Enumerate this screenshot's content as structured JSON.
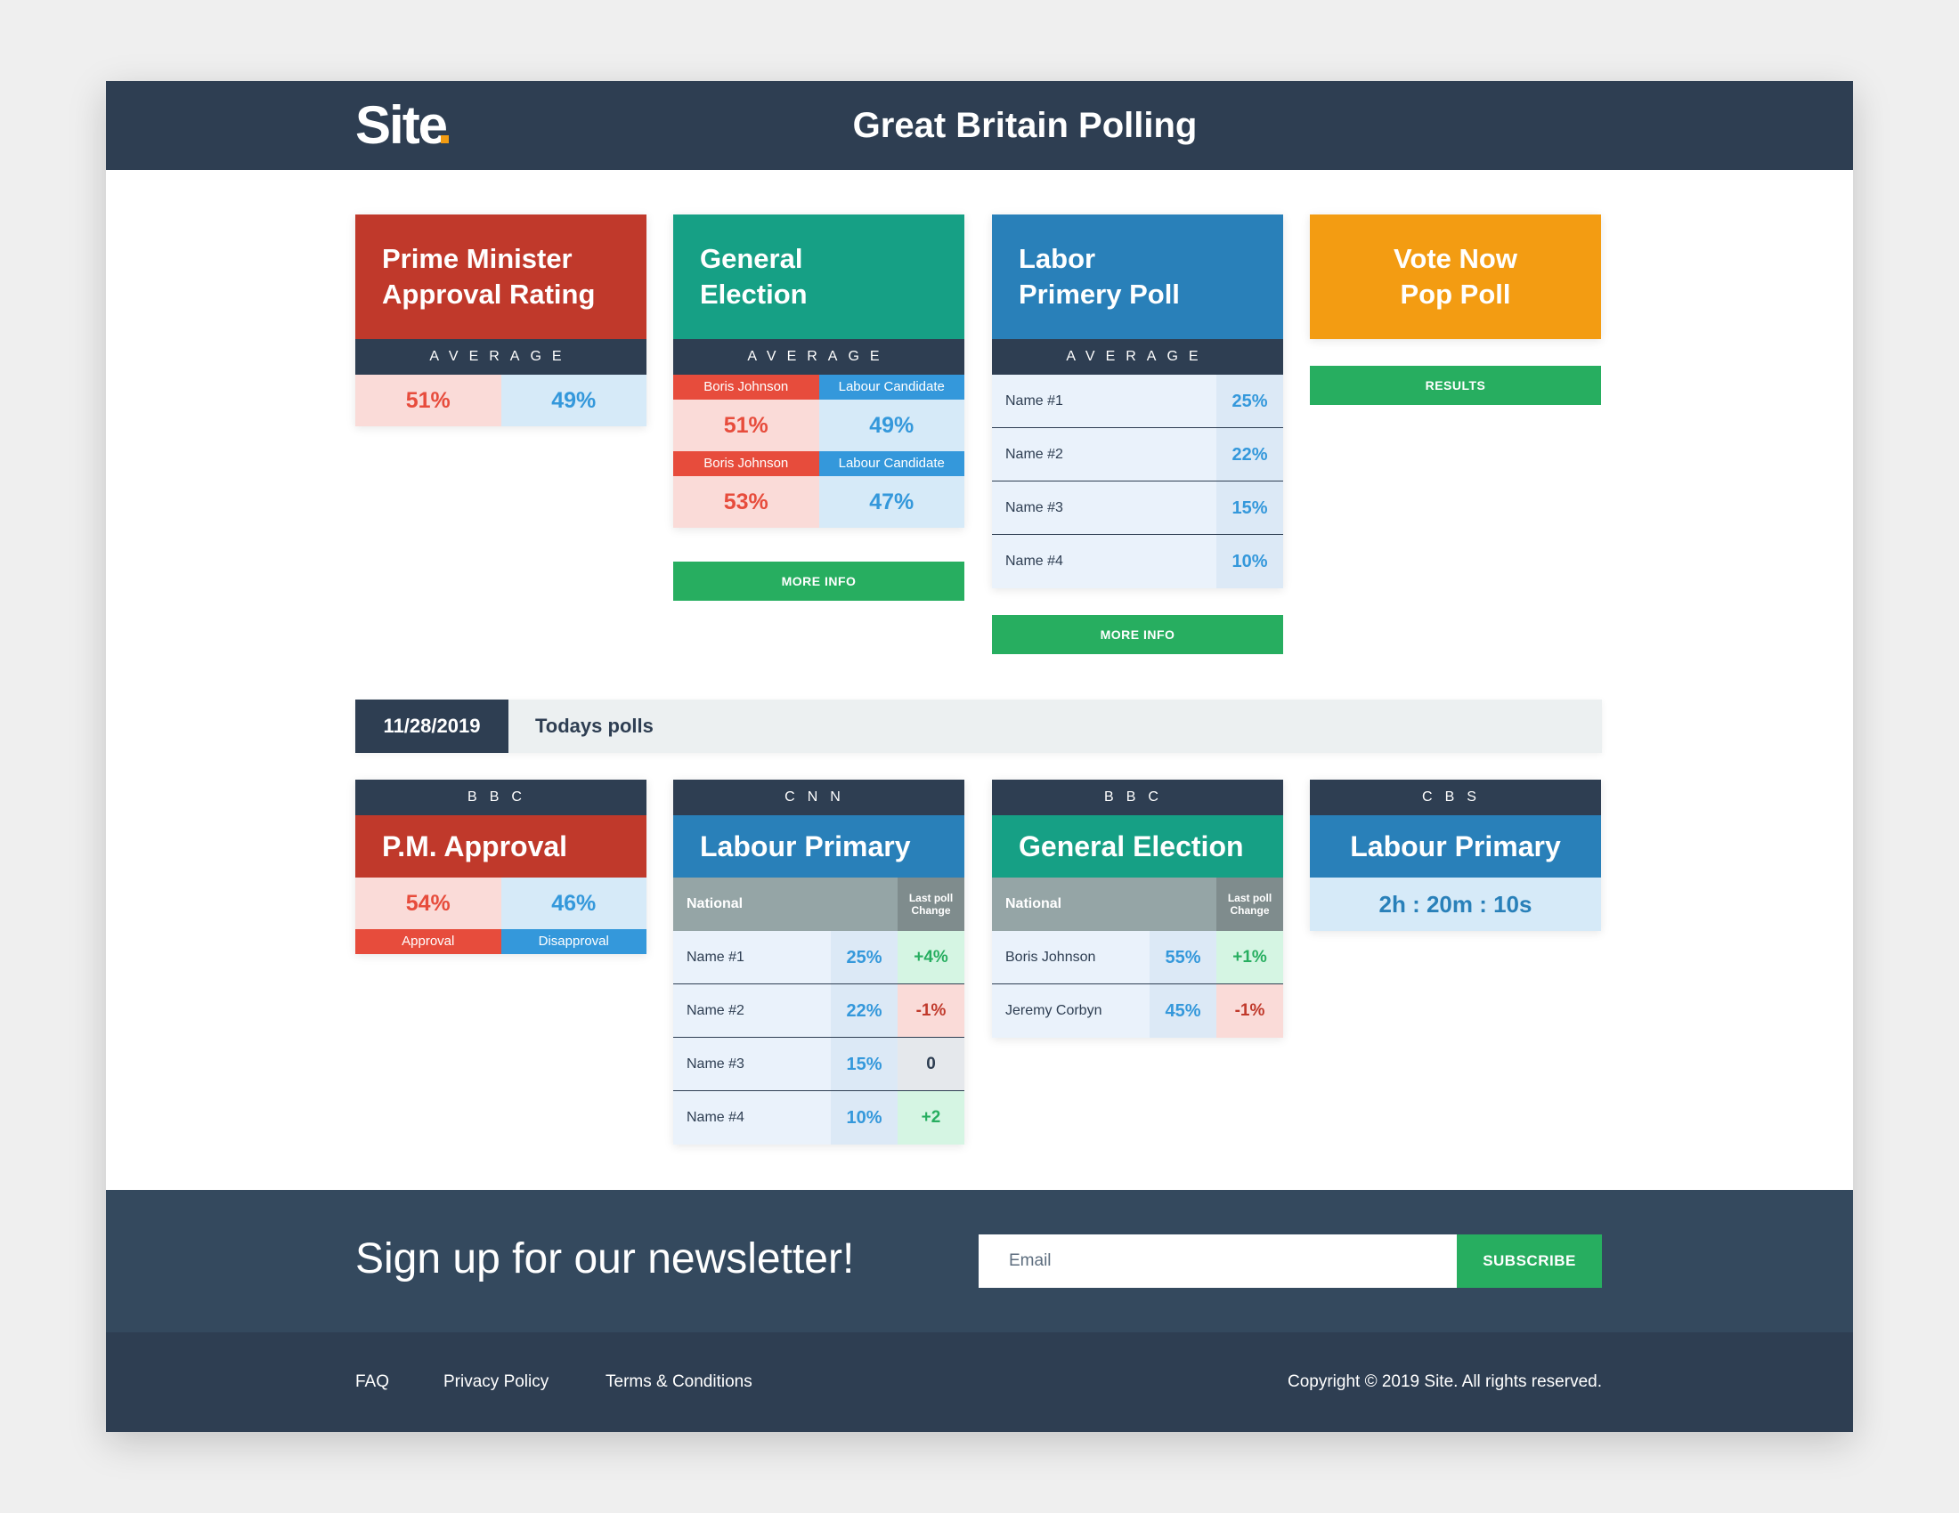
{
  "header": {
    "logo": "Site",
    "title": "Great Britain Polling"
  },
  "cards": {
    "pm": {
      "title_line1": "Prime Minister",
      "title_line2": "Approval Rating",
      "avg_label": "AVERAGE",
      "left": "51%",
      "right": "49%"
    },
    "general": {
      "title_line1": "General",
      "title_line2": "Election",
      "avg_label": "AVERAGE",
      "rows": [
        {
          "left_label": "Boris Johnson",
          "right_label": "Labour Candidate",
          "left": "51%",
          "right": "49%"
        },
        {
          "left_label": "Boris Johnson",
          "right_label": "Labour Candidate",
          "left": "53%",
          "right": "47%"
        }
      ],
      "button": "MORE INFO"
    },
    "labor": {
      "title_line1": "Labor",
      "title_line2": "Primery Poll",
      "avg_label": "AVERAGE",
      "rows": [
        {
          "name": "Name #1",
          "pct": "25%"
        },
        {
          "name": "Name #2",
          "pct": "22%"
        },
        {
          "name": "Name #3",
          "pct": "15%"
        },
        {
          "name": "Name #4",
          "pct": "10%"
        }
      ],
      "button": "MORE INFO"
    },
    "vote": {
      "title_line1": "Vote Now",
      "title_line2": "Pop Poll",
      "button": "RESULTS"
    }
  },
  "today": {
    "date": "11/28/2019",
    "label": "Todays polls"
  },
  "polls": {
    "bbc_pm": {
      "source": "BBC",
      "title": "P.M. Approval",
      "left": "54%",
      "right": "46%",
      "left_label": "Approval",
      "right_label": "Disapproval"
    },
    "cnn": {
      "source": "CNN",
      "title": "Labour Primary",
      "col_a": "National",
      "col_b_line1": "Last poll",
      "col_b_line2": "Change",
      "rows": [
        {
          "name": "Name #1",
          "pct": "25%",
          "change": "+4%"
        },
        {
          "name": "Name #2",
          "pct": "22%",
          "change": "-1%"
        },
        {
          "name": "Name #3",
          "pct": "15%",
          "change": "0"
        },
        {
          "name": "Name #4",
          "pct": "10%",
          "change": "+2"
        }
      ]
    },
    "bbc_ge": {
      "source": "BBC",
      "title": "General Election",
      "col_a": "National",
      "col_b_line1": "Last poll",
      "col_b_line2": "Change",
      "rows": [
        {
          "name": "Boris Johnson",
          "pct": "55%",
          "change": "+1%"
        },
        {
          "name": "Jeremy Corbyn",
          "pct": "45%",
          "change": "-1%"
        }
      ]
    },
    "cbs": {
      "source": "CBS",
      "title": "Labour Primary",
      "timer": "2h : 20m : 10s"
    }
  },
  "newsletter": {
    "title": "Sign up for our newsletter!",
    "email_placeholder": "Email",
    "button": "SUBSCRIBE"
  },
  "footer": {
    "links": [
      "FAQ",
      "Privacy Policy",
      "Terms & Conditions"
    ],
    "copyright": "Copyright © 2019 Site. All rights reserved."
  },
  "colors": {
    "navy": "#2e3e52",
    "red": "#c0392b",
    "teal": "#16a085",
    "blue": "#2980b9",
    "orange": "#f39c12",
    "green": "#27ae60"
  }
}
